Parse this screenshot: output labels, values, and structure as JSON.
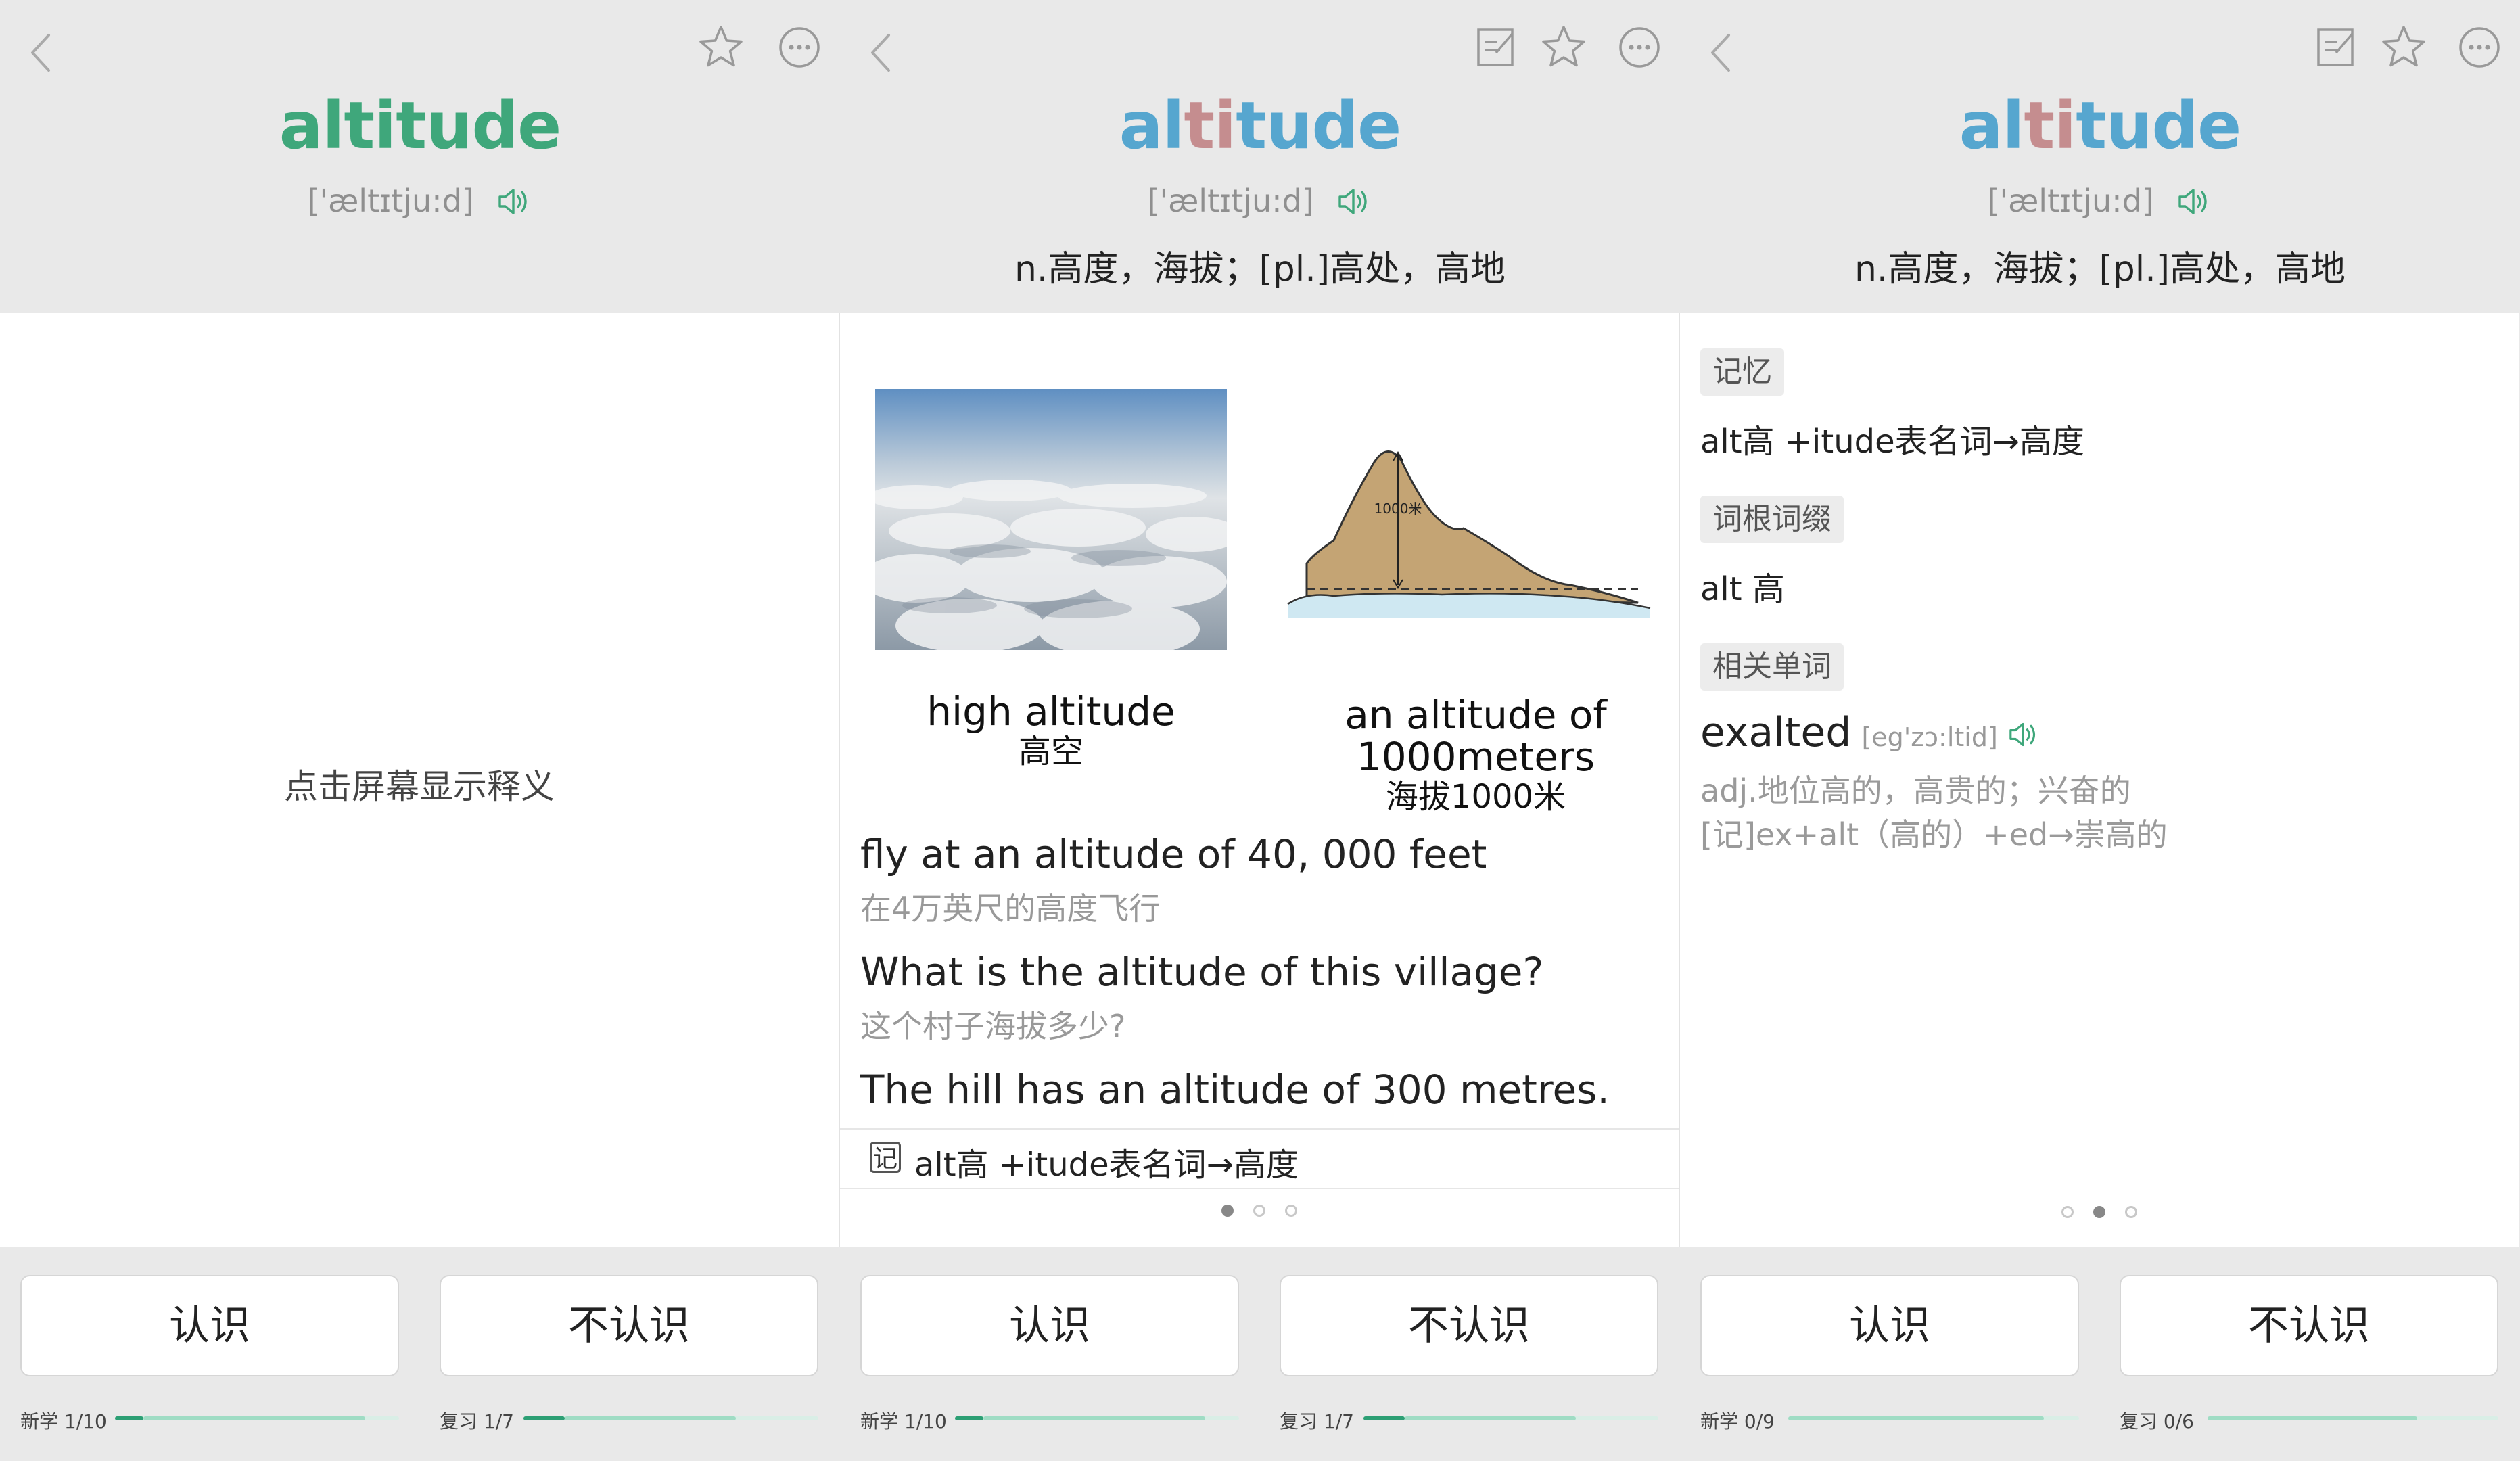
{
  "panels": [
    {
      "word": "altitude",
      "phonetic": "['æltɪtju:d]",
      "tap_hint": "点击屏幕显示释义",
      "buttons": {
        "know": "认识",
        "dont_know": "不认识"
      },
      "progress": [
        {
          "label": "新学 1/10",
          "done_fraction": 0.1,
          "seen_fraction": 0.88
        },
        {
          "label": "复习 1/7",
          "done_fraction": 0.14,
          "seen_fraction": 0.72
        }
      ]
    },
    {
      "word_parts": [
        "al",
        "ti",
        "tude"
      ],
      "phonetic": "['æltɪtju:d]",
      "definition": "n.高度，海拔；[pl.]高处，高地",
      "images": [
        {
          "caption_en": "high altitude",
          "caption_cn": "高空"
        },
        {
          "caption_en_line1": "an altitude of",
          "caption_en_line2": "1000meters",
          "caption_cn": "海拔1000米",
          "inner_label": "1000米"
        }
      ],
      "examples": [
        {
          "en": "fly at an altitude of 40, 000 feet",
          "cn": "在4万英尺的高度飞行"
        },
        {
          "en": "What is the altitude of this village?",
          "cn": "这个村子海拔多少?"
        },
        {
          "en": "The hill has an altitude of 300 metres.",
          "cn": ""
        }
      ],
      "memo_icon": "记",
      "memo": "alt高 +itude表名词→高度",
      "page_dots": {
        "count": 3,
        "active": 0
      },
      "buttons": {
        "know": "认识",
        "dont_know": "不认识"
      },
      "progress": [
        {
          "label": "新学 1/10",
          "done_fraction": 0.1,
          "seen_fraction": 0.88
        },
        {
          "label": "复习 1/7",
          "done_fraction": 0.14,
          "seen_fraction": 0.72
        }
      ]
    },
    {
      "word_parts": [
        "al",
        "ti",
        "tude"
      ],
      "phonetic": "['æltɪtju:d]",
      "definition": "n.高度，海拔；[pl.]高处，高地",
      "sections": {
        "memory_tag": "记忆",
        "memory_text": "alt高 +itude表名词→高度",
        "root_tag": "词根词缀",
        "root_text": "alt 高",
        "related_tag": "相关单词"
      },
      "related": {
        "word": "exalted",
        "phonetic": "[eg'zɔ:ltid]",
        "meaning": "adj.地位高的，高贵的；兴奋的",
        "memo": "[记]ex+alt（高的）+ed→崇高的"
      },
      "page_dots": {
        "count": 3,
        "active": 1
      },
      "buttons": {
        "know": "认识",
        "dont_know": "不认识"
      },
      "progress": [
        {
          "label": "新学 0/9",
          "done_fraction": 0.0,
          "seen_fraction": 0.88
        },
        {
          "label": "复习 0/6",
          "done_fraction": 0.0,
          "seen_fraction": 0.72
        }
      ]
    }
  ],
  "icons": {
    "back": "chevron-left-icon",
    "note": "note-edit-icon",
    "favorite": "star-icon",
    "more": "more-dots-icon",
    "audio": "speaker-icon"
  },
  "colors": {
    "accent_green": "#3fa77b",
    "word_blue": "#56a6cf",
    "highlight_pink": "#c58d8f",
    "progress_green": "#2c9f74"
  }
}
